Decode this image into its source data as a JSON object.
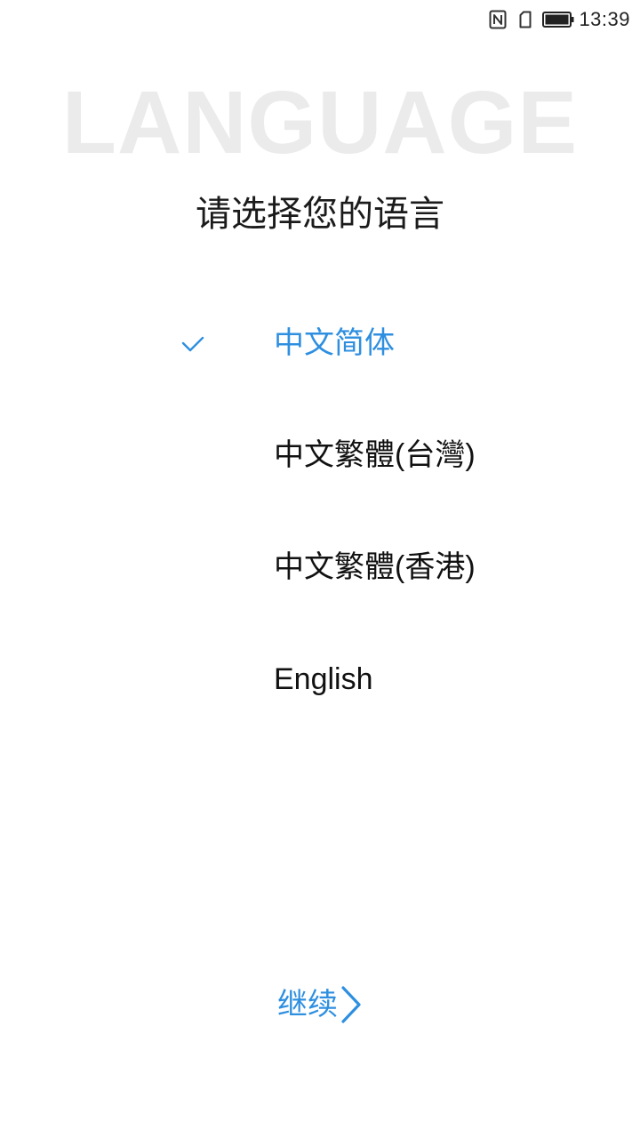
{
  "status_bar": {
    "time": "13:39",
    "icons": [
      "nfc-icon",
      "sim-icon",
      "battery-icon"
    ]
  },
  "watermark": "LANGUAGE",
  "title": "请选择您的语言",
  "languages": [
    {
      "label": "中文简体",
      "selected": true
    },
    {
      "label": "中文繁體(台灣)",
      "selected": false
    },
    {
      "label": "中文繁體(香港)",
      "selected": false
    },
    {
      "label": "English",
      "selected": false
    }
  ],
  "continue_label": "继续",
  "colors": {
    "accent": "#2e8fe0",
    "watermark": "#ebebeb",
    "text": "#111111"
  }
}
